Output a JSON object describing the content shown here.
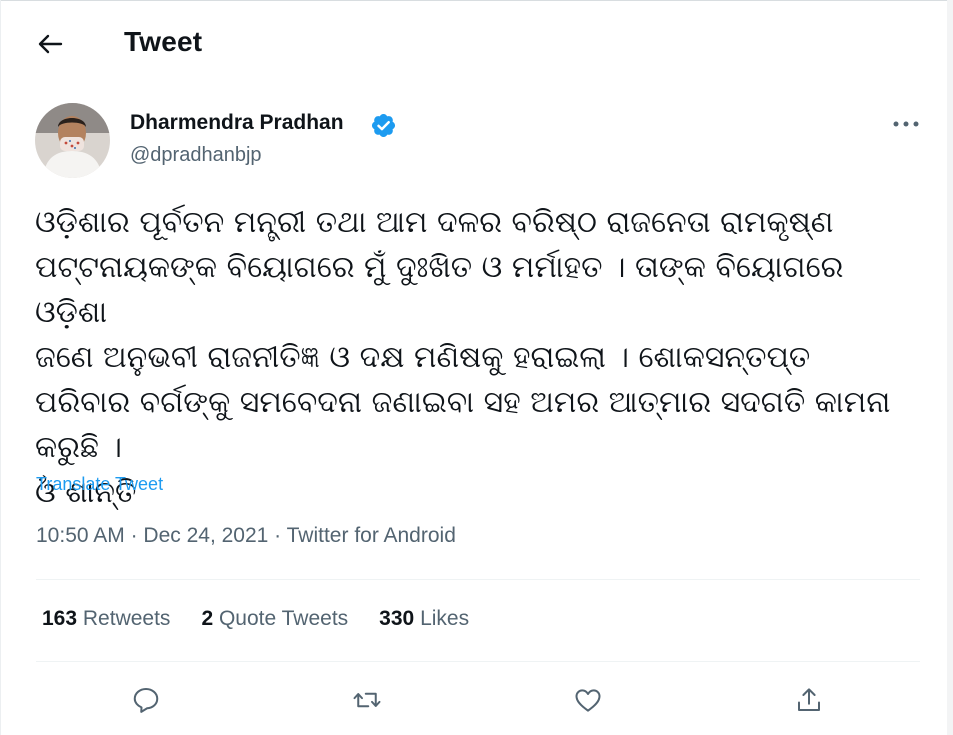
{
  "header": {
    "title": "Tweet"
  },
  "tweet": {
    "author_name": "Dharmendra Pradhan",
    "handle": "@dpradhanbjp",
    "text": "ଓଡ଼ିଶାର ପୂର୍ବତନ ମନ୍ତ୍ରୀ ତଥା ଆମ ଦଳର ବରିଷ୍ଠ ରାଜନେତା ରାମକୃଷ୍ଣ\nପଟ୍ଟନାୟକଙ୍କ ବିୟୋଗରେ ମୁଁ ଦୁଃଖିତ ଓ ମର୍ମାହତ । ତାଙ୍କ ବିୟୋଗରେ ଓଡ଼ିଶା\nଜଣେ ଅନୁଭବୀ ରାଜନୀତିଜ୍ଞ ଓ ଦକ୍ଷ ମଣିଷକୁ ହରାଇଲା । ଶୋକସନ୍ତପ୍ତ\nପରିବାର ବର୍ଗଙ୍କୁ ସମବେଦନା ଜଣାଇବା ସହ ଅମର ଆତ୍ମାର ସଦଗତି କାମନା\nକରୁଛି ।\nଓଁ ଶାନ୍ତି",
    "translate_label": "Translate Tweet",
    "time": "10:50 AM",
    "date": "Dec 24, 2021",
    "source": "Twitter for Android",
    "separator": " · "
  },
  "stats": [
    {
      "count": "163",
      "label": "Retweets"
    },
    {
      "count": "2",
      "label": "Quote Tweets"
    },
    {
      "count": "330",
      "label": "Likes"
    }
  ],
  "icons": {
    "back": "arrow-left-icon",
    "verified": "verified-badge-icon",
    "more": "more-horizontal-icon",
    "reply": "reply-icon",
    "retweet": "retweet-icon",
    "like": "heart-icon",
    "share": "share-icon"
  },
  "colors": {
    "text": "#0f1419",
    "secondary": "#536471",
    "accent": "#1d9bf0",
    "divider": "#eff3f4"
  }
}
